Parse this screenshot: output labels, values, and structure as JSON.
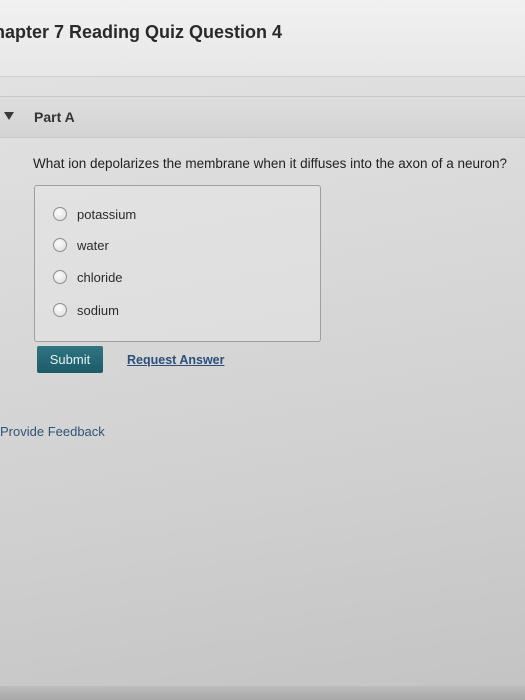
{
  "header": {
    "title": "hapter 7 Reading Quiz Question 4"
  },
  "part": {
    "label": "Part A"
  },
  "question": {
    "prompt": "What ion depolarizes the membrane when it diffuses into the axon of a neuron?",
    "choices": [
      {
        "label": "potassium",
        "selected": false
      },
      {
        "label": "water",
        "selected": false
      },
      {
        "label": "chloride",
        "selected": false
      },
      {
        "label": "sodium",
        "selected": false
      }
    ]
  },
  "actions": {
    "submit_label": "Submit",
    "request_answer_label": "Request Answer"
  },
  "footer": {
    "feedback_label": "Provide Feedback"
  },
  "colors": {
    "submit_bg": "#24687a",
    "link": "#2c4f7a"
  }
}
